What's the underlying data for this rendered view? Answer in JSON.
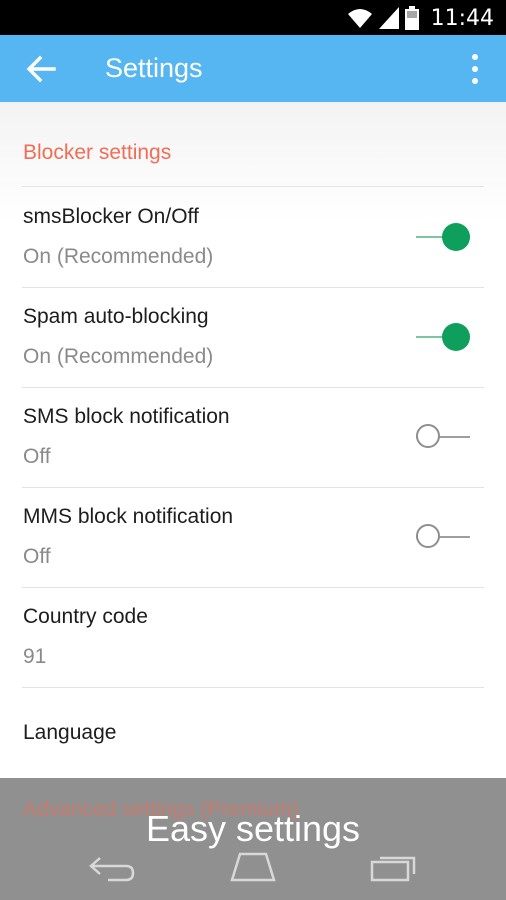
{
  "status_bar": {
    "time": "11:44",
    "icons": [
      "wifi-icon",
      "signal-icon",
      "battery-icon"
    ]
  },
  "app_bar": {
    "title": "Settings",
    "back_icon": "arrow-left-icon",
    "menu_icon": "more-vert-icon",
    "color": "#56b6f2"
  },
  "section": {
    "header": "Blocker settings",
    "header_color": "#f26d54"
  },
  "settings": [
    {
      "title": "smsBlocker On/Off",
      "subtitle": "On (Recommended)",
      "switch": true
    },
    {
      "title": "Spam auto-blocking",
      "subtitle": "On (Recommended)",
      "switch": true
    },
    {
      "title": "SMS block notification",
      "subtitle": "Off",
      "switch": false
    },
    {
      "title": "MMS block notification",
      "subtitle": "Off",
      "switch": false
    },
    {
      "title": "Country code",
      "subtitle": "91"
    },
    {
      "title": "Language"
    }
  ],
  "advanced_section": {
    "header": "Advanced settings (Premium)"
  },
  "overlay_caption": "Easy settings",
  "nav_bar": {
    "icons": [
      "nav-back-icon",
      "nav-home-icon",
      "nav-recents-icon"
    ]
  },
  "colors": {
    "switch_on": "#0d9f5b",
    "switch_off": "#8e8e8e"
  }
}
